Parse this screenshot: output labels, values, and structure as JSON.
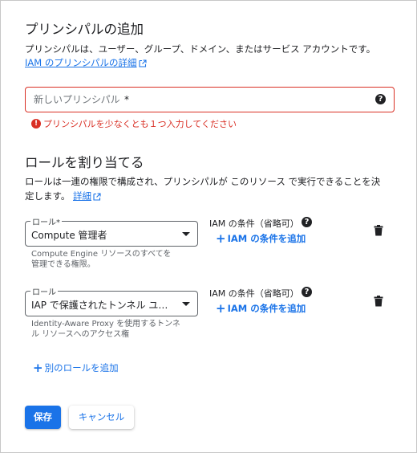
{
  "principals": {
    "title": "プリンシパルの追加",
    "description": "プリンシパルは、ユーザー、グループ、ドメイン、またはサービス アカウントです。",
    "details_link": "IAM のプリンシパルの詳細",
    "input_placeholder": "新しいプリンシパル",
    "required_mark": "*",
    "error": "プリンシパルを少なくとも１つ入力してください"
  },
  "roles": {
    "title": "ロールを割り当てる",
    "description_line1": "ロールは一連の権限で構成され、プリンシパルが このリソース で実行できることを決",
    "description_line2": "定します。",
    "details_link": "詳細",
    "add_role": "別のロールを追加",
    "items": [
      {
        "label": "ロール",
        "required_mark": "*",
        "value": "Compute 管理者",
        "hint_line1": "Compute Engine リソースのすべてを",
        "hint_line2": "管理できる権限。",
        "condition_title": "IAM の条件（省略可）",
        "add_condition": "IAM の条件を追加"
      },
      {
        "label": "ロール",
        "required_mark": "",
        "value": "IAP で保護されたトンネル ユーザー",
        "hint_line1": "Identity-Aware Proxy を使用するトンネ",
        "hint_line2": "ル リソースへのアクセス権",
        "condition_title": "IAM の条件（省略可）",
        "add_condition": "IAM の条件を追加"
      }
    ]
  },
  "actions": {
    "save": "保存",
    "cancel": "キャンセル"
  },
  "icons": {
    "help": "help-icon",
    "error": "error-icon",
    "external_link": "open-in-new-icon",
    "delete": "trash-icon",
    "add": "plus-icon"
  },
  "colors": {
    "accent": "#1a73e8",
    "error": "#d93025",
    "text": "#202124",
    "hint": "#5f6368"
  }
}
